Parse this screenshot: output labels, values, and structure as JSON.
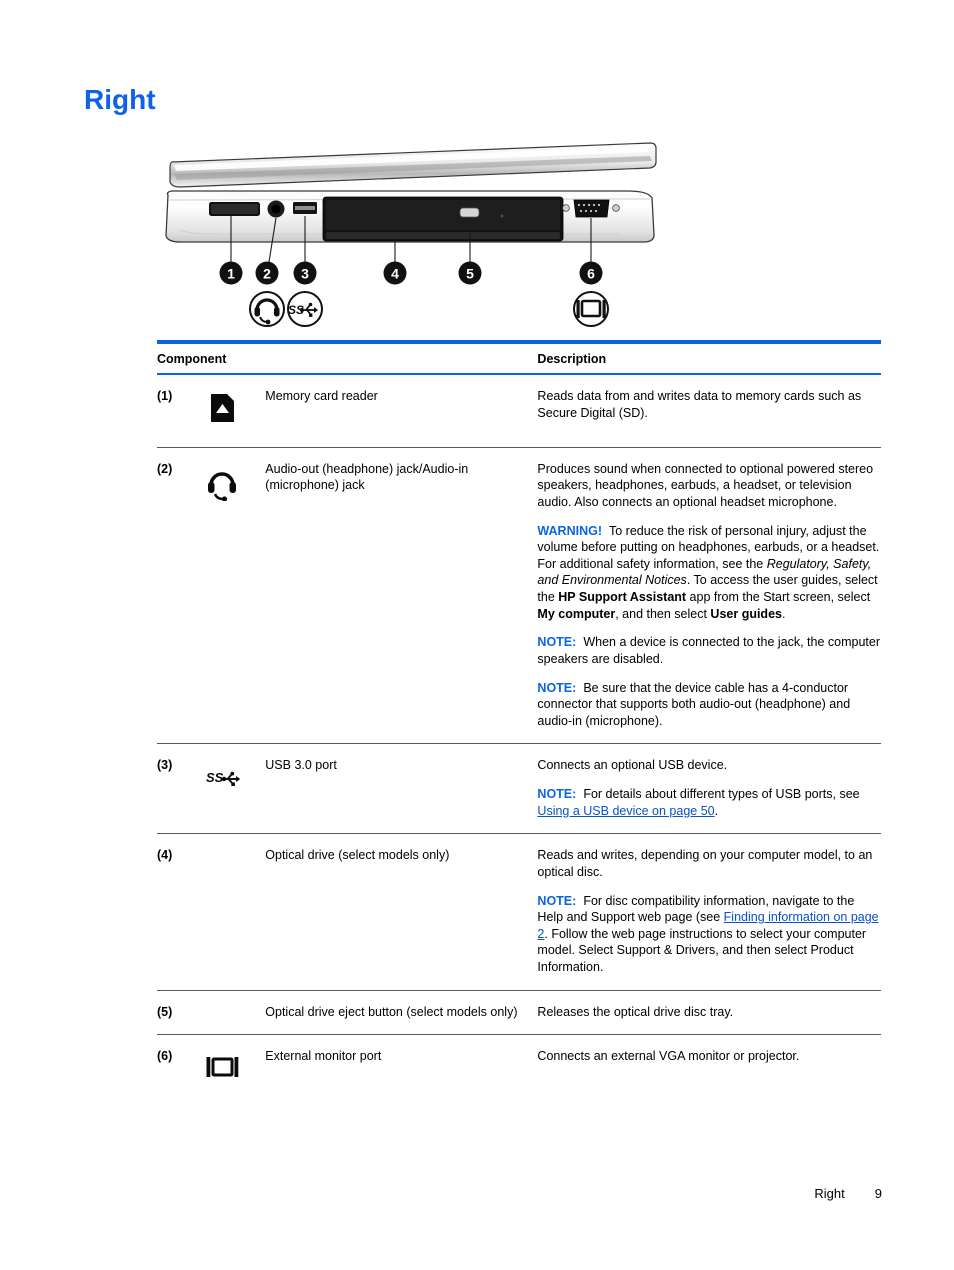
{
  "page": {
    "title": "Right",
    "footer_section": "Right",
    "footer_page_number": "9",
    "accent_color": "#0a64e6",
    "link_color": "#0a52c8"
  },
  "illustration": {
    "name": "laptop-right-side-view",
    "callouts": [
      "1",
      "2",
      "3",
      "4",
      "5",
      "6"
    ],
    "port_icons": [
      "headset-icon",
      "usb-superspeed-icon",
      "external-monitor-icon"
    ]
  },
  "table": {
    "headers": {
      "component": "Component",
      "description": "Description"
    },
    "rows": [
      {
        "num": "(1)",
        "icon": "memory-card-icon",
        "name": "Memory card reader",
        "desc": [
          {
            "label": "",
            "segments": [
              {
                "text": "Reads data from and writes data to memory cards such as Secure Digital (SD).",
                "style": "normal"
              }
            ]
          }
        ]
      },
      {
        "num": "(2)",
        "icon": "headset-icon",
        "name": "Audio-out (headphone) jack/Audio-in (microphone) jack",
        "desc": [
          {
            "label": "",
            "segments": [
              {
                "text": "Produces sound when connected to optional powered stereo speakers, headphones, earbuds, a headset, or television audio. Also connects an optional headset microphone.",
                "style": "normal"
              }
            ]
          },
          {
            "label": "WARNING!",
            "segments": [
              {
                "text": "To reduce the risk of personal injury, adjust the volume before putting on headphones, earbuds, or a headset. For additional safety information, see the ",
                "style": "normal"
              },
              {
                "text": "Regulatory, Safety, and Environmental Notices",
                "style": "italic"
              },
              {
                "text": ". To access the user guides, select the ",
                "style": "normal"
              },
              {
                "text": "HP Support Assistant",
                "style": "bold"
              },
              {
                "text": " app from the Start screen, select ",
                "style": "normal"
              },
              {
                "text": "My computer",
                "style": "bold"
              },
              {
                "text": ", and then select ",
                "style": "normal"
              },
              {
                "text": "User guides",
                "style": "bold"
              },
              {
                "text": ".",
                "style": "normal"
              }
            ]
          },
          {
            "label": "NOTE:",
            "segments": [
              {
                "text": "When a device is connected to the jack, the computer speakers are disabled.",
                "style": "normal"
              }
            ]
          },
          {
            "label": "NOTE:",
            "segments": [
              {
                "text": "Be sure that the device cable has a 4-conductor connector that supports both audio-out (headphone) and audio-in (microphone).",
                "style": "normal"
              }
            ]
          }
        ]
      },
      {
        "num": "(3)",
        "icon": "usb-superspeed-icon",
        "name": "USB 3.0 port",
        "desc": [
          {
            "label": "",
            "segments": [
              {
                "text": "Connects an optional USB device.",
                "style": "normal"
              }
            ]
          },
          {
            "label": "NOTE:",
            "segments": [
              {
                "text": "For details about different types of USB ports, see ",
                "style": "normal"
              },
              {
                "text": "Using a USB device on page 50",
                "style": "link"
              },
              {
                "text": ".",
                "style": "normal"
              }
            ]
          }
        ]
      },
      {
        "num": "(4)",
        "icon": "",
        "name": "Optical drive (select models only)",
        "desc": [
          {
            "label": "",
            "segments": [
              {
                "text": "Reads and writes, depending on your computer model, to an optical disc.",
                "style": "normal"
              }
            ]
          },
          {
            "label": "NOTE:",
            "segments": [
              {
                "text": "For disc compatibility information, navigate to the Help and Support web page (see ",
                "style": "normal"
              },
              {
                "text": "Finding information on page 2",
                "style": "link"
              },
              {
                "text": ". Follow the web page instructions to select your computer model. Select Support & Drivers, and then select Product Information.",
                "style": "normal"
              }
            ]
          }
        ]
      },
      {
        "num": "(5)",
        "icon": "",
        "name": "Optical drive eject button (select models only)",
        "desc": [
          {
            "label": "",
            "segments": [
              {
                "text": "Releases the optical drive disc tray.",
                "style": "normal"
              }
            ]
          }
        ]
      },
      {
        "num": "(6)",
        "icon": "external-monitor-icon",
        "name": "External monitor port",
        "desc": [
          {
            "label": "",
            "segments": [
              {
                "text": "Connects an external VGA monitor or projector.",
                "style": "normal"
              }
            ]
          }
        ]
      }
    ]
  }
}
